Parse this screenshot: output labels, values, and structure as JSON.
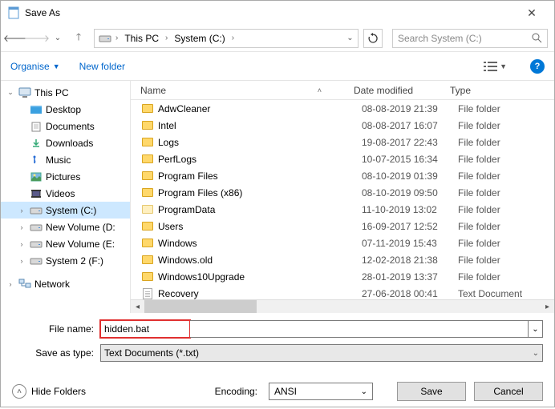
{
  "title": "Save As",
  "breadcrumb": {
    "root": "This PC",
    "drive": "System (C:)"
  },
  "search_placeholder": "Search System (C:)",
  "toolbar": {
    "organise": "Organise",
    "new_folder": "New folder"
  },
  "tree": {
    "thispc": "This PC",
    "items": [
      {
        "label": "Desktop"
      },
      {
        "label": "Documents"
      },
      {
        "label": "Downloads"
      },
      {
        "label": "Music"
      },
      {
        "label": "Pictures"
      },
      {
        "label": "Videos"
      },
      {
        "label": "System (C:)"
      },
      {
        "label": "New Volume (D:"
      },
      {
        "label": "New Volume (E:"
      },
      {
        "label": "System 2 (F:)"
      }
    ],
    "network": "Network"
  },
  "columns": {
    "name": "Name",
    "date": "Date modified",
    "type": "Type"
  },
  "files": [
    {
      "name": "AdwCleaner",
      "date": "08-08-2019 21:39",
      "type": "File folder",
      "kind": "folder"
    },
    {
      "name": "Intel",
      "date": "08-08-2017 16:07",
      "type": "File folder",
      "kind": "folder"
    },
    {
      "name": "Logs",
      "date": "19-08-2017 22:43",
      "type": "File folder",
      "kind": "folder"
    },
    {
      "name": "PerfLogs",
      "date": "10-07-2015 16:34",
      "type": "File folder",
      "kind": "folder"
    },
    {
      "name": "Program Files",
      "date": "08-10-2019 01:39",
      "type": "File folder",
      "kind": "folder"
    },
    {
      "name": "Program Files (x86)",
      "date": "08-10-2019 09:50",
      "type": "File folder",
      "kind": "folder"
    },
    {
      "name": "ProgramData",
      "date": "11-10-2019 13:02",
      "type": "File folder",
      "kind": "folder-faded"
    },
    {
      "name": "Users",
      "date": "16-09-2017 12:52",
      "type": "File folder",
      "kind": "folder"
    },
    {
      "name": "Windows",
      "date": "07-11-2019 15:43",
      "type": "File folder",
      "kind": "folder"
    },
    {
      "name": "Windows.old",
      "date": "12-02-2018 21:38",
      "type": "File folder",
      "kind": "folder"
    },
    {
      "name": "Windows10Upgrade",
      "date": "28-01-2019 13:37",
      "type": "File folder",
      "kind": "folder"
    },
    {
      "name": "Recovery",
      "date": "27-06-2018 00:41",
      "type": "Text Document",
      "kind": "doc"
    }
  ],
  "form": {
    "filename_label": "File name:",
    "filename_value": "hidden.bat",
    "type_label": "Save as type:",
    "type_value": "Text Documents (*.txt)"
  },
  "footer": {
    "hide": "Hide Folders",
    "encoding_label": "Encoding:",
    "encoding_value": "ANSI",
    "save": "Save",
    "cancel": "Cancel"
  }
}
